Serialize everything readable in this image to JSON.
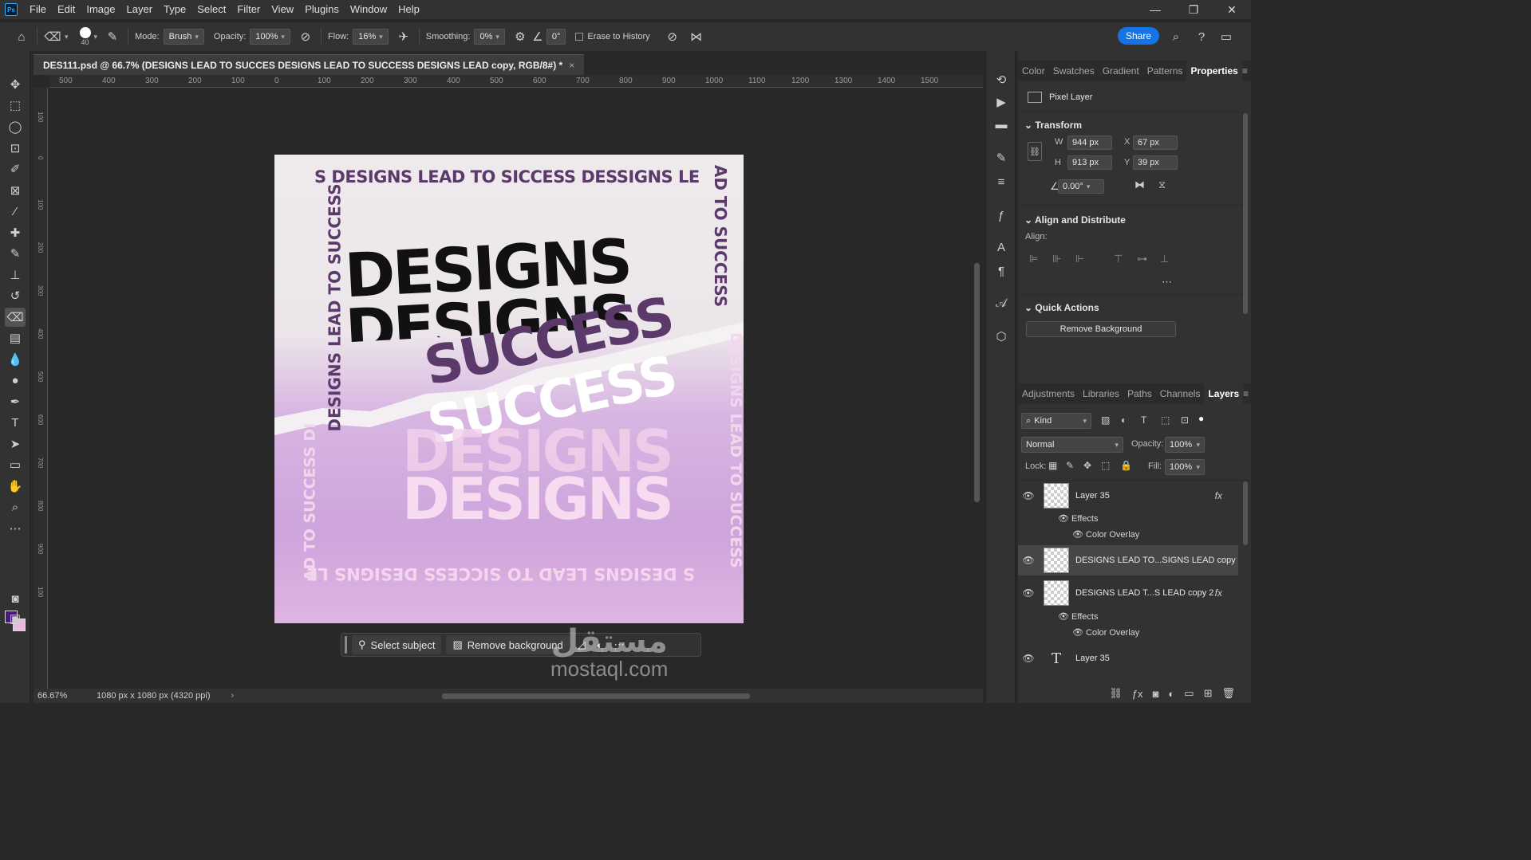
{
  "menubar": {
    "logo": "Ps",
    "items": [
      "File",
      "Edit",
      "Image",
      "Layer",
      "Type",
      "Select",
      "Filter",
      "View",
      "Plugins",
      "Window",
      "Help"
    ],
    "controls": [
      "—",
      "❐",
      "✕"
    ]
  },
  "options": {
    "brush_size": "40",
    "mode_label": "Mode:",
    "mode_value": "Brush",
    "opacity_label": "Opacity:",
    "opacity_value": "100%",
    "flow_label": "Flow:",
    "flow_value": "16%",
    "smoothing_label": "Smoothing:",
    "smoothing_value": "0%",
    "angle_value": "0°",
    "erase_history_label": "Erase to History",
    "share_label": "Share"
  },
  "document": {
    "tab_title": "DES111.psd @ 66.7% (DESIGNS LEAD TO SUCCES DESIGNS LEAD TO SUCCESS  DESIGNS LEAD copy, RGB/8#) *",
    "ruler_ticks": [
      "500",
      "400",
      "300",
      "200",
      "100",
      "0",
      "100",
      "200",
      "300",
      "400",
      "500",
      "600",
      "700",
      "800",
      "900",
      "1000",
      "1100",
      "1200",
      "1300",
      "1400",
      "1500"
    ],
    "vruler_ticks": [
      "100",
      "0",
      "100",
      "200",
      "300",
      "400",
      "500",
      "600",
      "700",
      "800",
      "900",
      "100"
    ],
    "zoom": "66.67%",
    "dimensions": "1080 px x 1080 px (4320 ppi)"
  },
  "artwork": {
    "top_border": "S  DESIGNS LEAD TO SICCESS    DESSIGNS  LE",
    "left_border": "DESIGNS LEAD TO SUCCESS",
    "right_border": "AD TO SUCCESS",
    "right_border_lower": "DESIGNS LEAD TO SUCCESS",
    "left_border_lower": "AD TO SUCCESS DI",
    "bottom_border": "S DESIGNS LEAD TO SICCESS DESIGNS LE",
    "main_1": "DESIGNS",
    "main_2": "DESIGNS",
    "success_1": "SUCCESS",
    "success_2": "SUCCESS",
    "faded_1": "DESIGNS",
    "faded_2": "DESIGNS"
  },
  "context_bar": {
    "select_subject": "Select subject",
    "remove_background": "Remove background"
  },
  "watermark": {
    "arabic": "مستقل",
    "latin": "mostaql.com"
  },
  "properties_panel": {
    "tabs": [
      "Color",
      "Swatches",
      "Gradient",
      "Patterns",
      "Properties"
    ],
    "active_tab": "Properties",
    "layer_kind": "Pixel Layer",
    "transform_header": "Transform",
    "w_label": "W",
    "w_value": "944 px",
    "h_label": "H",
    "h_value": "913 px",
    "x_label": "X",
    "x_value": "67 px",
    "y_label": "Y",
    "y_value": "39 px",
    "angle_value": "0.00°",
    "align_header": "Align and Distribute",
    "align_label": "Align:",
    "quick_actions_header": "Quick Actions",
    "remove_bg_button": "Remove Background"
  },
  "layers_panel": {
    "tabs": [
      "Adjustments",
      "Libraries",
      "Paths",
      "Channels",
      "Layers"
    ],
    "active_tab": "Layers",
    "kind_filter": "Kind",
    "blend_mode": "Normal",
    "opacity_label": "Opacity:",
    "opacity_value": "100%",
    "lock_label": "Lock:",
    "fill_label": "Fill:",
    "fill_value": "100%",
    "layers": [
      {
        "name": "Layer 35",
        "fx": "fx",
        "effects": "Effects",
        "effect": "Color Overlay"
      },
      {
        "name": "DESIGNS LEAD TO...SIGNS LEAD copy"
      },
      {
        "name": "DESIGNS LEAD T...S LEAD copy 2",
        "fx": "fx",
        "effects": "Effects",
        "effect": "Color Overlay"
      },
      {
        "name": "Layer 35"
      }
    ]
  },
  "colors": {
    "accent": "#1473e6",
    "foreground_swatch": "#4a1a7a",
    "background_swatch": "#e8b8e0"
  }
}
